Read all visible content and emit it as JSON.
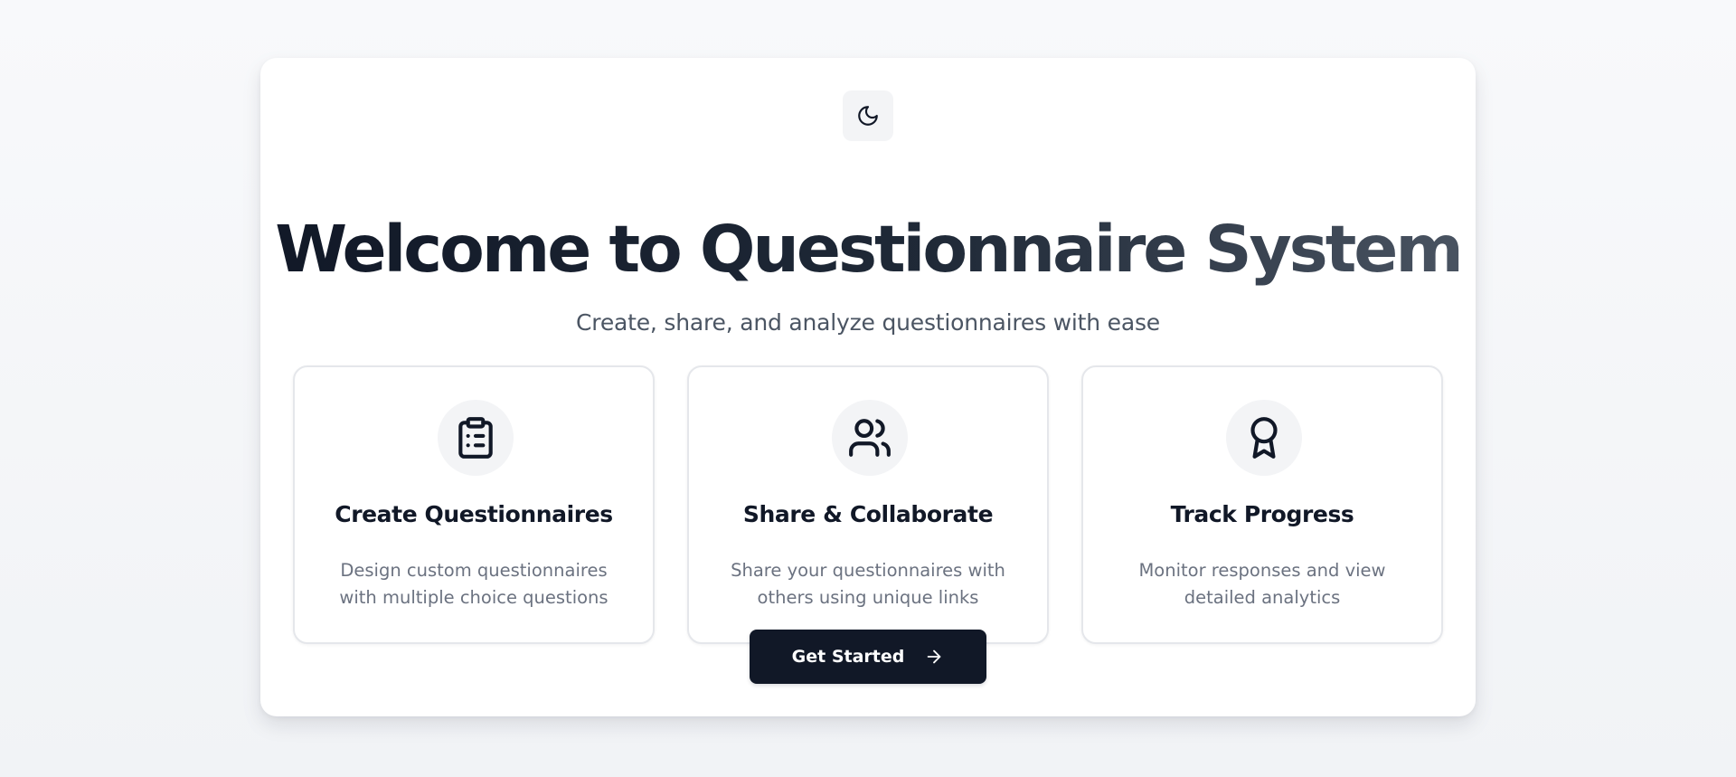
{
  "header": {
    "theme_toggle_icon": "moon-icon",
    "title": "Welcome to Questionnaire System",
    "subtitle": "Create, share, and analyze questionnaires with ease"
  },
  "features": [
    {
      "icon": "clipboard-list-icon",
      "title": "Create Questionnaires",
      "description": "Design custom questionnaires with multiple choice questions"
    },
    {
      "icon": "users-icon",
      "title": "Share & Collaborate",
      "description": "Share your questionnaires with others using unique links"
    },
    {
      "icon": "award-icon",
      "title": "Track Progress",
      "description": "Monitor responses and view detailed analytics"
    }
  ],
  "cta": {
    "label": "Get Started",
    "icon": "arrow-right-icon"
  },
  "colors": {
    "primary": "#111827",
    "muted_text": "#6b7280",
    "icon_bg": "#f3f4f6",
    "border": "#e5e7eb"
  }
}
